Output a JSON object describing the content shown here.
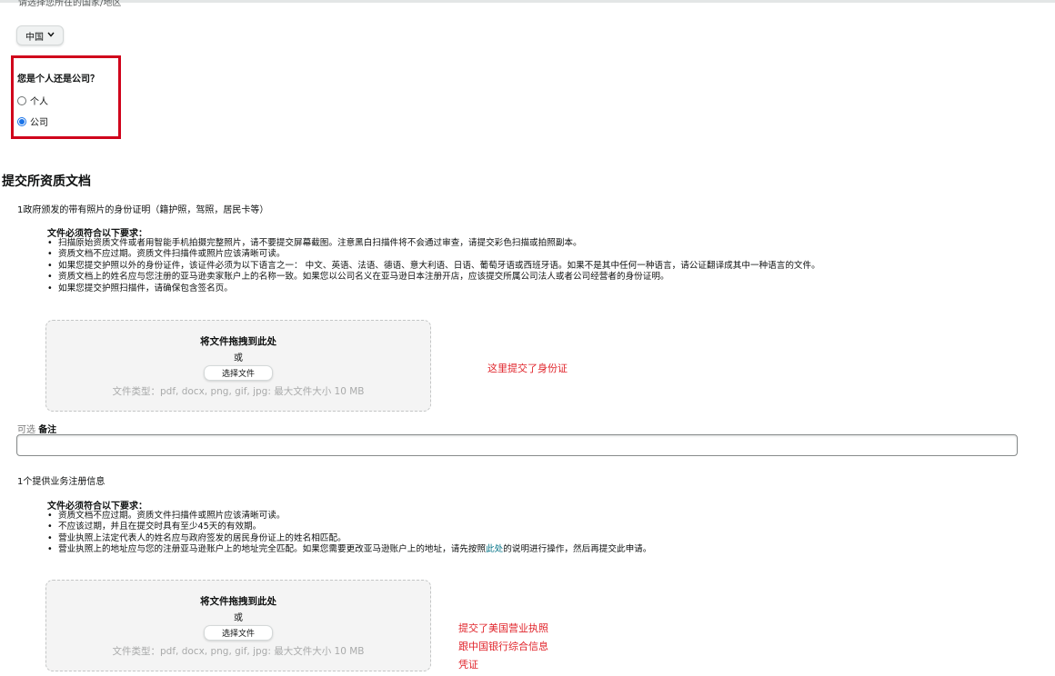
{
  "country": {
    "label": "请选择您所在的国家/地区",
    "selected": "中国"
  },
  "entity": {
    "question": "您是个人还是公司？",
    "options": [
      {
        "label": "个人",
        "checked": false
      },
      {
        "label": "公司",
        "checked": true
      }
    ]
  },
  "section_title": "提交所资质文档",
  "doc1": {
    "label": "1政府颁发的带有照片的身份证明（籍护照，驾照，居民卡等）",
    "req_title": "文件必须符合以下要求：",
    "reqs": [
      "扫描原始资质文件或者用智能手机拍摄完整照片，请不要提交屏幕截图。注意黑白扫描件将不会通过审查，请提交彩色扫描或拍照副本。",
      "资质文档不应过期。资质文件扫描件或照片应该清晰可读。",
      "如果您提交护照以外的身份证件，该证件必须为以下语言之一： 中文、英语、法语、德语、意大利语、日语、葡萄牙语或西班牙语。如果不是其中任何一种语言，请公证翻译成其中一种语言的文件。",
      "资质文档上的姓名应与您注册的亚马逊卖家账户上的名称一致。如果您以公司名义在亚马逊日本注册开店，应该提交所属公司法人或者公司经营者的身份证明。",
      "如果您提交护照扫描件，请确保包含签名页。"
    ],
    "annotation": "这里提交了身份证"
  },
  "dropzone": {
    "title": "将文件拖拽到此处",
    "or": "或",
    "button": "选择文件",
    "types": "文件类型：pdf, docx, png, gif, jpg: 最大文件大小 10 MB"
  },
  "remark": {
    "optional": "可选",
    "label": "备注"
  },
  "doc2": {
    "label": "1个提供业务注册信息",
    "req_title": "文件必须符合以下要求：",
    "reqs": [
      "资质文档不应过期。资质文件扫描件或照片应该清晰可读。",
      "不应该过期，并且在提交时具有至少45天的有效期。",
      "营业执照上法定代表人的姓名应与政府签发的居民身份证上的姓名相匹配。"
    ],
    "req4_pre": "营业执照上的地址应与您的注册亚马逊账户上的地址完全匹配。如果您需要更改亚马逊账户上的地址，请先按照",
    "req4_link": "此处",
    "req4_post": "的说明进行操作，然后再提交此申请。",
    "annotations": [
      "提交了美国营业执照",
      "跟中国银行综合信息",
      "凭证"
    ]
  },
  "colors": {
    "highlight_box": "#d0021b",
    "annotation_red": "#e0242b",
    "link": "#007185",
    "radio_selected": "#1a73e8"
  }
}
